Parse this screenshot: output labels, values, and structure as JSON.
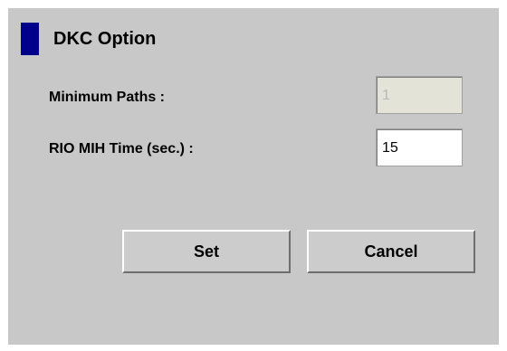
{
  "dialog": {
    "title": "DKC Option",
    "accent_color": "#00008b",
    "background_color": "#c8c8c8"
  },
  "fields": {
    "minimum_paths": {
      "label": "Minimum Paths :",
      "value": "1",
      "enabled": false
    },
    "rio_mih_time": {
      "label": "RIO MIH Time (sec.) :",
      "value": "15",
      "enabled": true
    }
  },
  "buttons": {
    "set_label": "Set",
    "cancel_label": "Cancel"
  }
}
